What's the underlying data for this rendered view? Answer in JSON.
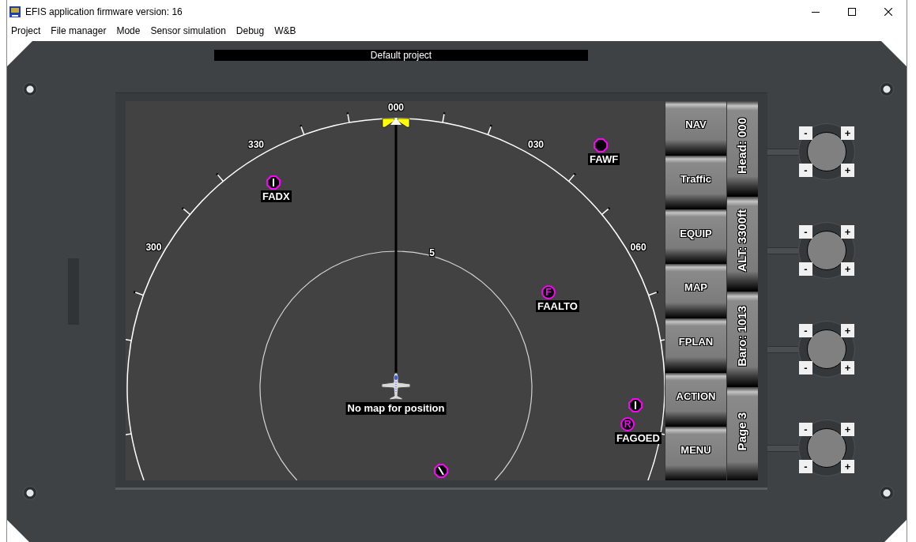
{
  "window": {
    "title": "EFIS application firmware version: 16"
  },
  "menu": [
    "Project",
    "File manager",
    "Mode",
    "Sensor simulation",
    "Debug",
    "W&B"
  ],
  "project_title": "Default project",
  "map": {
    "compass_labels": [
      "300",
      "330",
      "000",
      "030",
      "060"
    ],
    "range_label": "5",
    "waypoints": [
      {
        "kind": "runway",
        "slanted": false,
        "label": "FADX"
      },
      {
        "kind": "dot",
        "label": "FAWF"
      },
      {
        "kind": "letter",
        "symbol": "F",
        "label": "FAALTO"
      },
      {
        "kind": "runway",
        "slanted": false
      },
      {
        "kind": "letter",
        "symbol": "R",
        "label": "FAGOED"
      },
      {
        "kind": "runway",
        "slanted": true
      }
    ],
    "message": "No map for position"
  },
  "soft_keys": [
    "NAV",
    "Traffic",
    "EQUIP",
    "MAP",
    "FPLAN",
    "ACTION",
    "MENU"
  ],
  "readouts": [
    "Head: 000",
    "ALT: 3300ft",
    "Baro: 1013",
    "Page 3"
  ],
  "knobs": [
    {
      "buttons": [
        "-",
        "+",
        "-",
        "+"
      ]
    },
    {
      "buttons": [
        "-",
        "+",
        "-",
        "+"
      ]
    },
    {
      "buttons": [
        "-",
        "+",
        "-",
        "+"
      ]
    },
    {
      "buttons": [
        "-",
        "+",
        "-",
        "+"
      ]
    }
  ]
}
